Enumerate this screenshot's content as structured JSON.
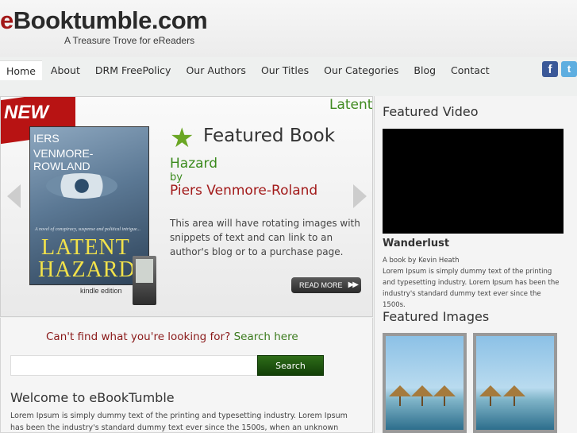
{
  "header": {
    "logo_e": "e",
    "logo_rest": "Booktumble.com",
    "tagline": "A Treasure Trove for eReaders"
  },
  "nav": {
    "items": [
      "Home",
      "About",
      "DRM FreePolicy",
      "Our Authors",
      "Our Titles",
      "Our Categories",
      "Blog",
      "Contact"
    ],
    "active": "Home"
  },
  "social": {
    "facebook_glyph": "f",
    "twitter_glyph": "t"
  },
  "slider": {
    "badge": "NEW",
    "tab_label": "Latent",
    "heading": "Featured Book",
    "book_title": "Hazard",
    "by": "by",
    "author": "Piers Venmore-Roland",
    "description": "This area will have rotating images with snippets of text and can link to an author's blog or to a purchase page.",
    "read_more": "READ MORE",
    "cover": {
      "author_line1": "IERS",
      "author_line2": "VENMORE-ROWLAND",
      "subtitle": "A novel of conspiracy, suspense and political intrigue...",
      "title_line1": "LATENT",
      "title_line2": "HAZARD",
      "kindle_label": "kindle edition"
    }
  },
  "search": {
    "prompt_red": "Can't find what you're looking for?",
    "prompt_green": "Search here",
    "placeholder": "",
    "button": "Search"
  },
  "welcome": {
    "heading": "Welcome to eBookTumble",
    "text": "Lorem Ipsum is simply dummy text of the printing and typesetting industry. Lorem Ipsum has been the industry's standard dummy text ever since the 1500s, when an unknown printer took a galley of type and"
  },
  "sidebar": {
    "video_heading": "Featured Video",
    "video_title": "Wanderlust",
    "video_author": "A book by Kevin Heath",
    "video_text": "Lorem Ipsum is simply dummy text of the printing and typesetting industry. Lorem Ipsum has been the industry's standard dummy text ever since the 1500s.",
    "images_heading": "Featured Images"
  },
  "colors": {
    "brand_red": "#a21818",
    "brand_green": "#3a8a1c",
    "search_button": "#1f5610"
  }
}
